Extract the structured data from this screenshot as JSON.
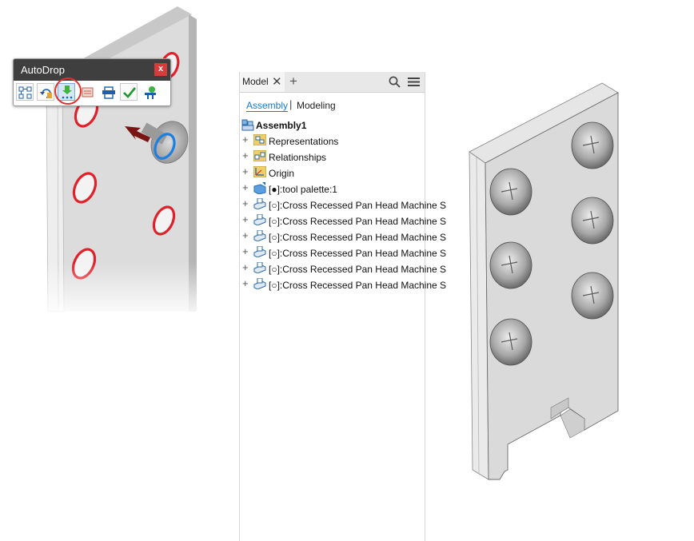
{
  "autodrop": {
    "title": "AutoDrop",
    "close_label": "x",
    "tools": [
      {
        "name": "autodrop-browse-icon"
      },
      {
        "name": "autodrop-rotate-icon"
      },
      {
        "name": "autodrop-insert-icon"
      },
      {
        "name": "autodrop-change-size-icon"
      },
      {
        "name": "autodrop-fasteners-icon"
      },
      {
        "name": "autodrop-apply-icon"
      },
      {
        "name": "autodrop-done-icon"
      }
    ]
  },
  "browser": {
    "tab_label": "Model",
    "tab_close": "✕",
    "tab_add": "+",
    "mode_assembly": "Assembly",
    "mode_separator": "|",
    "mode_modeling": "Modeling",
    "root_label": "Assembly1",
    "nodes": [
      {
        "label": "Representations",
        "icon": "representations-icon"
      },
      {
        "label": "Relationships",
        "icon": "relationships-icon"
      },
      {
        "label": "Origin",
        "icon": "origin-icon"
      },
      {
        "label": "[●]:tool palette:1",
        "icon": "part-icon"
      },
      {
        "label": "[○]:Cross Recessed Pan Head Machine S",
        "icon": "fastener-icon"
      },
      {
        "label": "[○]:Cross Recessed Pan Head Machine S",
        "icon": "fastener-icon"
      },
      {
        "label": "[○]:Cross Recessed Pan Head Machine S",
        "icon": "fastener-icon"
      },
      {
        "label": "[○]:Cross Recessed Pan Head Machine S",
        "icon": "fastener-icon"
      },
      {
        "label": "[○]:Cross Recessed Pan Head Machine S",
        "icon": "fastener-icon"
      },
      {
        "label": "[○]:Cross Recessed Pan Head Machine S",
        "icon": "fastener-icon"
      }
    ]
  },
  "colors": {
    "accent": "#1a7ac4",
    "hole_highlight": "#e0202a",
    "target_highlight": "#1f7fe0",
    "title_bar": "#3f3f3f",
    "close_button": "#d93b3b"
  }
}
